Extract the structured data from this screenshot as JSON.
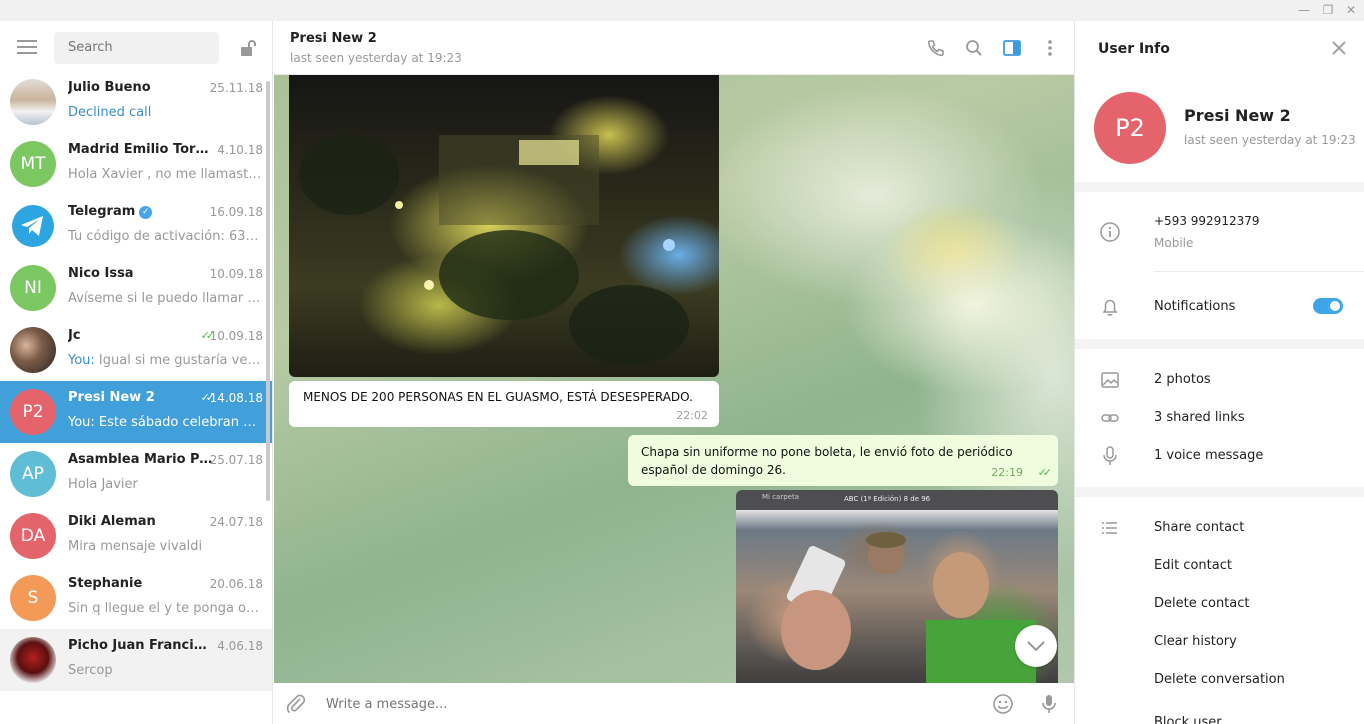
{
  "window": {
    "minimize": "—",
    "restore": "❐",
    "close": "✕"
  },
  "sidebar": {
    "search_placeholder": "Search",
    "chats": [
      {
        "initials": "AP",
        "name": "",
        "date": "",
        "preview": "👌👌",
        "color": "#5fbed5"
      },
      {
        "initials": "",
        "name": "Julio Bueno",
        "date": "25.11.18",
        "preview": "Declined call",
        "color": "#c4b9ae"
      },
      {
        "initials": "MT",
        "name": "Madrid Emilio Torres",
        "date": "4.10.18",
        "preview": "Hola Xavier , no me llamaste y …",
        "color": "#7bc862"
      },
      {
        "initials": "",
        "name": "Telegram",
        "date": "16.09.18",
        "preview": "Tu código de activación: 63664 …",
        "color": "#2ca5e0"
      },
      {
        "initials": "NI",
        "name": "Nico Issa",
        "date": "10.09.18",
        "preview": "Avíseme si le puedo llamar por …",
        "color": "#7bc862"
      },
      {
        "initials": "",
        "name": "Jc",
        "date": "10.09.18",
        "preview_you": "You:",
        "preview": " Igual si me gustaría verlo s…",
        "color": "#6b4a3a"
      },
      {
        "initials": "P2",
        "name": "Presi New 2",
        "date": "14.08.18",
        "preview_you": "You:",
        "preview": " Este sábado celebran 4 a…",
        "color": "#e5636b"
      },
      {
        "initials": "AP",
        "name": "Asamblea Mario Paz…",
        "date": "25.07.18",
        "preview": "Hola Javier",
        "color": "#5fbed5"
      },
      {
        "initials": "DA",
        "name": "Diki Aleman",
        "date": "24.07.18",
        "preview": "Mira mensaje vivaldi",
        "color": "#e5636b"
      },
      {
        "initials": "S",
        "name": "Stephanie",
        "date": "20.06.18",
        "preview": "Sin q llegue el y te ponga obstá…",
        "color": "#f39a59"
      },
      {
        "initials": "",
        "name": "Picho Juan Francisco",
        "date": "4.06.18",
        "preview": "Sercop",
        "color": "#b41f1f"
      }
    ]
  },
  "chat": {
    "peer_name": "Presi New 2",
    "peer_status": "last seen yesterday at 19:23",
    "messages": [
      {
        "text": "MENOS DE 200 PERSONAS EN EL GUASMO, ESTÁ DESESPERADO.",
        "time": "22:02"
      },
      {
        "text": "Chapa sin uniforme no pone boleta, le envió foto de periódico español de domingo 26.",
        "time": "22:19"
      }
    ],
    "photo_caption": "ABC (1ª Edición)   8 de 96",
    "photo_folder": "Mi carpeta",
    "composer_placeholder": "Write a message..."
  },
  "user_info": {
    "title": "User Info",
    "initials": "P2",
    "name": "Presi New 2",
    "status": "last seen yesterday at 19:23",
    "phone": "+593 992912379",
    "phone_label": "Mobile",
    "notifications": "Notifications",
    "notifications_on": true,
    "photos": "2 photos",
    "links": "3 shared links",
    "voice": "1 voice message",
    "actions": [
      "Share contact",
      "Edit contact",
      "Delete contact",
      "Clear history",
      "Delete conversation",
      "Block user"
    ]
  },
  "colors": {
    "accent": "#419fd9",
    "outgoing_bubble": "#effdde",
    "avatar_red": "#e5636b"
  }
}
